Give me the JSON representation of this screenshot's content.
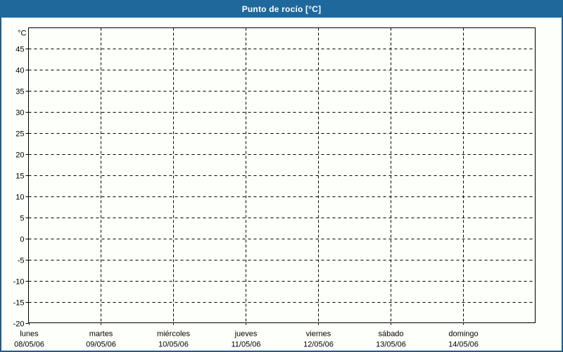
{
  "window": {
    "title": "Punto de rocío [°C]"
  },
  "colors": {
    "header_bg": "#1E689C",
    "frame_border": "#1B5E92",
    "background": "#FDFFFA",
    "grid": "#000000",
    "axis_text": "#000000",
    "title_text": "#FFFFFF"
  },
  "chart_data": {
    "type": "line",
    "title": "Punto de rocío [°C]",
    "ylabel": "°C",
    "grid": "dashed",
    "legend": "none",
    "y_axis": {
      "plot_min": -20,
      "plot_max": 50,
      "tick_step": 5,
      "tick_labels": [
        45,
        40,
        35,
        30,
        25,
        20,
        15,
        10,
        5,
        0,
        -5,
        -10,
        -15,
        -20
      ]
    },
    "x_axis": {
      "days": [
        {
          "name": "lunes",
          "date": "08/05/06"
        },
        {
          "name": "martes",
          "date": "09/05/06"
        },
        {
          "name": "miércoles",
          "date": "10/05/06"
        },
        {
          "name": "jueves",
          "date": "11/05/06"
        },
        {
          "name": "viernes",
          "date": "12/05/06"
        },
        {
          "name": "sábado",
          "date": "13/05/06"
        },
        {
          "name": "domingo",
          "date": "14/05/06"
        }
      ]
    },
    "series": []
  }
}
